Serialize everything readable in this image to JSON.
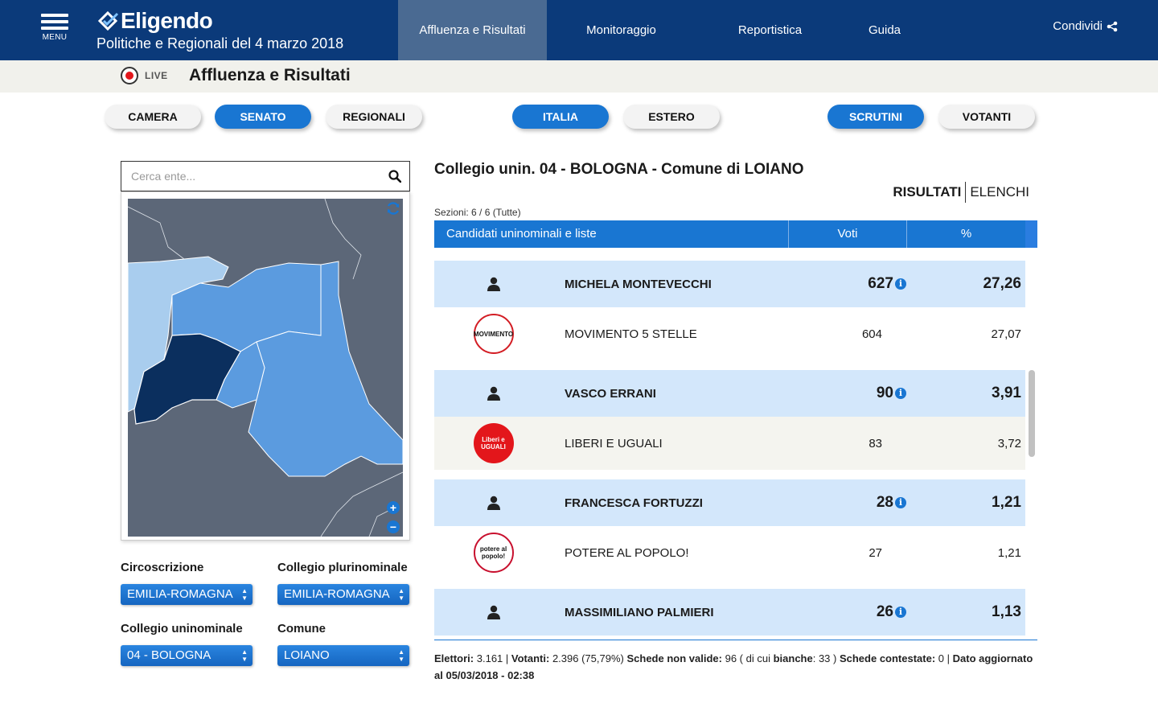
{
  "header": {
    "menu_label": "MENU",
    "brand": "Eligendo",
    "subtitle": "Politiche e Regionali del 4 marzo 2018",
    "nav": [
      {
        "label": "Affluenza e Risultati",
        "active": true
      },
      {
        "label": "Monitoraggio",
        "active": false
      },
      {
        "label": "Reportistica",
        "active": false
      },
      {
        "label": "Guida",
        "active": false
      }
    ],
    "share_label": "Condividi"
  },
  "subbar": {
    "live_label": "LIVE",
    "title": "Affluenza e Risultati"
  },
  "pills": {
    "election": [
      {
        "label": "CAMERA",
        "active": false
      },
      {
        "label": "SENATO",
        "active": true
      },
      {
        "label": "REGIONALI",
        "active": false
      }
    ],
    "area": [
      {
        "label": "ITALIA",
        "active": true
      },
      {
        "label": "ESTERO",
        "active": false
      }
    ],
    "mode": [
      {
        "label": "SCRUTINI",
        "active": true
      },
      {
        "label": "VOTANTI",
        "active": false
      }
    ]
  },
  "search": {
    "placeholder": "Cerca ente..."
  },
  "filters": {
    "circoscrizione": {
      "label": "Circoscrizione",
      "value": "EMILIA-ROMAGNA"
    },
    "plurinominale": {
      "label": "Collegio plurinominale",
      "value": "EMILIA-ROMAGNA"
    },
    "uninominale": {
      "label": "Collegio uninominale",
      "value": "04 - BOLOGNA"
    },
    "comune": {
      "label": "Comune",
      "value": "LOIANO"
    }
  },
  "results": {
    "title": "Collegio unin. 04 - BOLOGNA - Comune di LOIANO",
    "tabs": [
      {
        "label": "RISULTATI",
        "active": true
      },
      {
        "label": "ELENCHI",
        "active": false
      }
    ],
    "sezioni": "Sezioni: 6 / 6 (Tutte)",
    "columns": {
      "name": "Candidati uninominali e liste",
      "voti": "Voti",
      "pct": "%"
    },
    "rows": [
      {
        "kind": "cand",
        "name": "MICHELA MONTEVECCHI",
        "voti": "627",
        "pct": "27,26"
      },
      {
        "kind": "list",
        "name": "MOVIMENTO 5 STELLE",
        "voti": "604",
        "pct": "27,07",
        "logo": "m5s",
        "logo_text": "MOVIMENTO",
        "alt": false
      },
      {
        "kind": "cand",
        "name": "VASCO ERRANI",
        "voti": "90",
        "pct": "3,91"
      },
      {
        "kind": "list",
        "name": "LIBERI E UGUALI",
        "voti": "83",
        "pct": "3,72",
        "logo": "leu",
        "logo_text": "Liberi e UGUALI",
        "alt": true
      },
      {
        "kind": "cand",
        "name": "FRANCESCA FORTUZZI",
        "voti": "28",
        "pct": "1,21"
      },
      {
        "kind": "list",
        "name": "POTERE AL POPOLO!",
        "voti": "27",
        "pct": "1,21",
        "logo": "pap",
        "logo_text": "potere al popolo!",
        "alt": false
      },
      {
        "kind": "cand",
        "name": "MASSIMILIANO PALMIERI",
        "voti": "26",
        "pct": "1,13"
      }
    ]
  },
  "stats": {
    "elettori_label": "Elettori:",
    "elettori": "3.161",
    "votanti_label": "Votanti:",
    "votanti": "2.396 (75,79%)",
    "non_valide_label": "Schede non valide:",
    "non_valide": "96 ( di cui",
    "bianche_label": "bianche",
    "bianche": ": 33 )",
    "contestate_label": "Schede contestate:",
    "contestate": "0",
    "aggiornato_label": "Dato aggiornato al",
    "aggiornato": "05/03/2018 - 02:38"
  },
  "colors": {
    "header_bg": "#0b3a7a",
    "accent": "#1976d2",
    "map_dark": "#0b2f5e",
    "map_mid": "#5b9bdf",
    "map_light": "#a9cdee",
    "map_gray": "#5c6778"
  }
}
